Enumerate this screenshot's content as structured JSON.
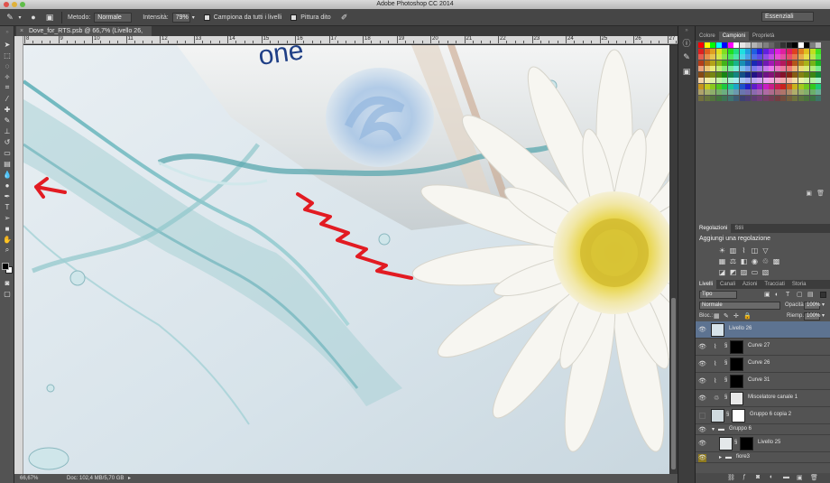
{
  "window": {
    "title": "Adobe Photoshop CC 2014"
  },
  "options_bar": {
    "mode_label": "Metodo:",
    "mode_value": "Normale",
    "intensity_label": "Intensità:",
    "intensity_value": "79%",
    "sample_all_label": "Campiona da tutti i livelli",
    "finger_paint_label": "Pittura dito",
    "workspace_value": "Essenziali"
  },
  "document": {
    "tab_title": "Dove_for_RTS.psb @ 66,7% (Livello 26, RGB/8) *",
    "ruler_numbers": [
      "8",
      "9",
      "10",
      "11",
      "12",
      "13",
      "14",
      "15",
      "16",
      "17",
      "18",
      "19",
      "20",
      "21",
      "22",
      "23",
      "24",
      "25",
      "26",
      "27"
    ],
    "canvas_text": "one"
  },
  "status_bar": {
    "zoom": "66,67%",
    "doc_info": "Doc: 102,4 MB/5,70 GB"
  },
  "swatches_panel": {
    "tabs": [
      "Colore",
      "Campioni",
      "Proprietà"
    ],
    "active_tab": "Campioni"
  },
  "adjustments_panel": {
    "tabs": [
      "Regolazioni",
      "Stili"
    ],
    "active_tab": "Regolazioni",
    "header": "Aggiungi una regolazione"
  },
  "layers_panel": {
    "tabs": [
      "Livelli",
      "Canali",
      "Azioni",
      "Tracciati",
      "Storia"
    ],
    "active_tab": "Livelli",
    "filter_value": "Tipo",
    "blend_mode": "Normale",
    "opacity_label": "Opacità:",
    "opacity_value": "100%",
    "lock_label": "Bloc.:",
    "fill_label": "Riemp.:",
    "fill_value": "100%",
    "layers": [
      {
        "name": "Livello 26"
      },
      {
        "name": "Curve 27"
      },
      {
        "name": "Curve 26"
      },
      {
        "name": "Curve 31"
      },
      {
        "name": "Miscelatore canale 1"
      },
      {
        "name": "Gruppo 6 copia 2"
      },
      {
        "name": "Gruppo 6"
      },
      {
        "name": "Livello 25"
      },
      {
        "name": "fiore3"
      }
    ]
  }
}
